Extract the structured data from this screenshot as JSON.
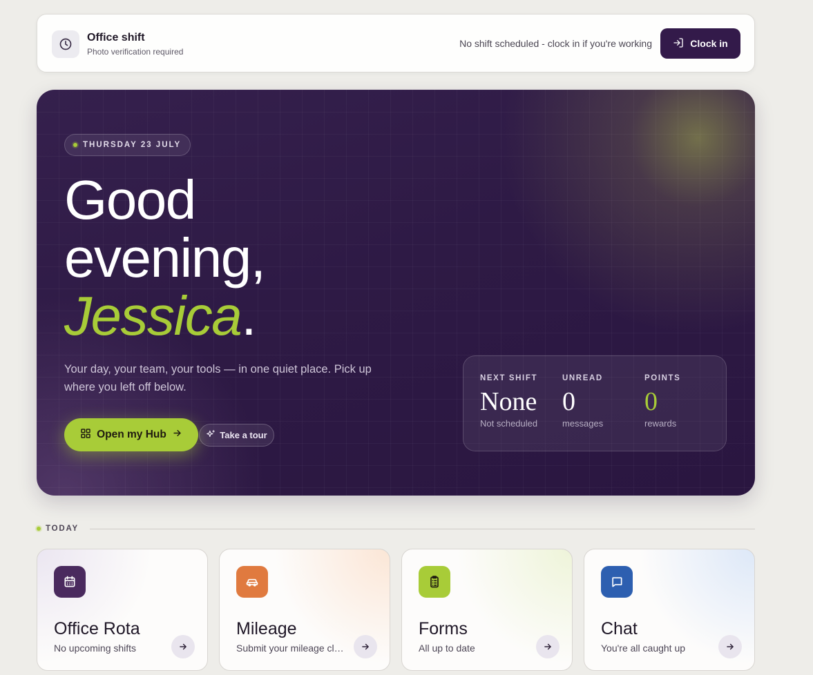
{
  "shift_bar": {
    "icon": "clock-icon",
    "title": "Office shift",
    "subtitle": "Photo verification required",
    "status": "No shift scheduled - clock in if you're working",
    "clock_in_label": "Clock in"
  },
  "hero": {
    "date": "THURSDAY 23 JULY",
    "greeting_line1": "Good",
    "greeting_line2": "evening,",
    "name": "Jessica",
    "name_suffix": ".",
    "description": "Your day, your team, your tools — in one quiet place. Pick up where you left off below.",
    "hub_button": "Open my Hub",
    "tour_button": "Take a tour",
    "stats": [
      {
        "label": "NEXT SHIFT",
        "value": "None",
        "caption": "Not scheduled"
      },
      {
        "label": "UNREAD",
        "value": "0",
        "caption": "messages"
      },
      {
        "label": "POINTS",
        "value": "0",
        "caption": "rewards"
      }
    ]
  },
  "today": {
    "label": "TODAY",
    "cards": [
      {
        "title": "Office Rota",
        "subtitle": "No upcoming shifts",
        "icon": "calendar-icon",
        "color": "#4a2a5e"
      },
      {
        "title": "Mileage",
        "subtitle": "Submit your mileage claims",
        "icon": "car-icon",
        "color": "#e07a3f"
      },
      {
        "title": "Forms",
        "subtitle": "All up to date",
        "icon": "clipboard-icon",
        "color": "#a8cc38"
      },
      {
        "title": "Chat",
        "subtitle": "You're all caught up",
        "icon": "chat-icon",
        "color": "#2d5fb0"
      }
    ]
  },
  "colors": {
    "brand_purple": "#331a4a",
    "accent_green": "#a8cc38",
    "background": "#eeede9"
  }
}
